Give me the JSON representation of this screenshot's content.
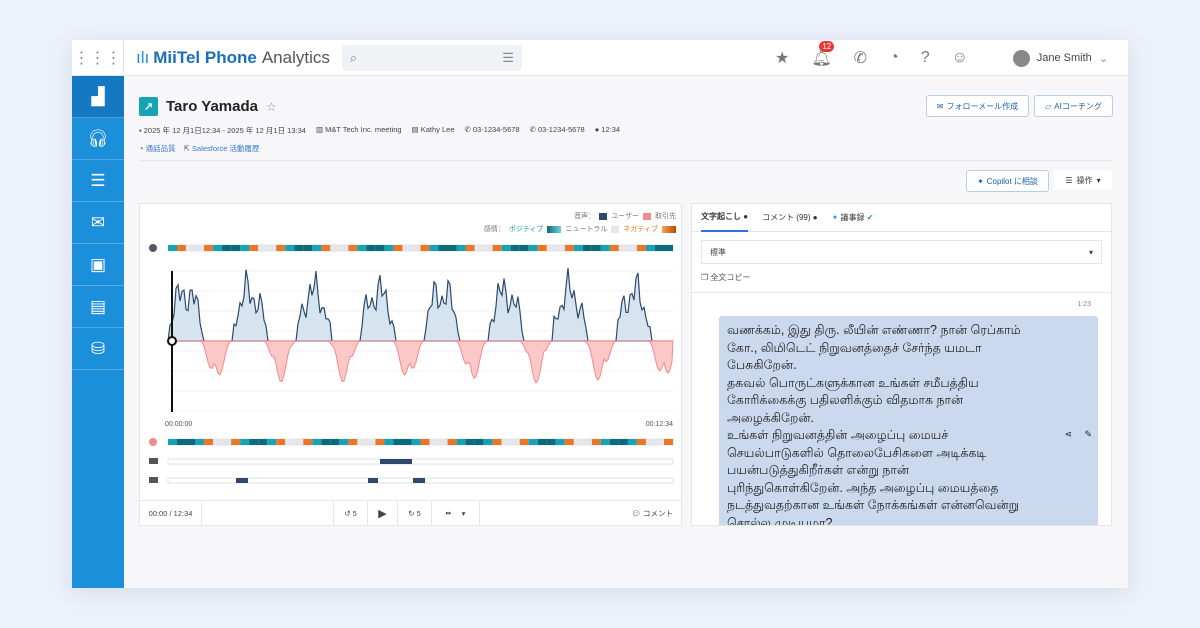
{
  "app": {
    "name_bold": "MiiTel",
    "name_rest": "Phone",
    "name_suffix": "Analytics",
    "notification_count": "12",
    "user": "Jane Smith"
  },
  "sidebar": {
    "items": [
      "analytics-icon",
      "headset-icon",
      "list-icon",
      "sms-icon",
      "contacts-icon",
      "clipboard-icon",
      "database-icon"
    ]
  },
  "record": {
    "title": "Taro Yamada",
    "datetime": "2025 年 12 月1日12:34 - 2025 年 12 月1日 13:34",
    "meeting": "M&T Tech Inc. meeting",
    "contact": "Kathy Lee",
    "phone_out": "03-1234-5678",
    "phone_in": "03-1234-5678",
    "duration": "12:34",
    "quality_link": "通話品質",
    "salesforce_link": "Salesforce 活動履歴"
  },
  "buttons": {
    "follow_mail": "フォローメール作成",
    "ai_coaching": "AIコーチング",
    "copilot": "Copilot に相談",
    "operations": "操作"
  },
  "player": {
    "legend_voice": "音声：",
    "legend_user": "ユーザー",
    "legend_client": "取引先",
    "legend_emotion": "感情：",
    "positive": "ポジティブ",
    "neutral": "ニュートラル",
    "negative": "ネガティブ",
    "time_start": "00:00:00",
    "time_end": "00:12:34",
    "position": "00:00 / 12:34",
    "skip_back": "5",
    "skip_fwd": "5",
    "comment": "コメント",
    "colors": {
      "user": "#2e4a6b",
      "client": "#f28b8b",
      "positive": "#15a3b5",
      "negative": "#e8772a"
    }
  },
  "transcript": {
    "tabs": [
      "文字起こし",
      "コメント (99)",
      "議事録"
    ],
    "mode": "標準",
    "copy_all": "全文コピー",
    "timestamp": "1:23",
    "text": "வணக்கம், இது திரு. லீயின் எண்ணா? நான் ரெப்காம்\nகோ., லிமிடெட் நிறுவனத்தைச் சேர்ந்த யமடா\nபேசுகிறேன்.\nதகவல் பொருட்களுக்கான உங்கள் சமீபத்திய\nகோரிக்கைக்கு பதிலளிக்கும் விதமாக நான்\nஅழைக்கிறேன்.\nஉங்கள் நிறுவனத்தின் அழைப்பு மையச்\nசெயல்பாடுகளில் தொலைபேசிகளை அடிக்கடி\nபயன்படுத்துகிறீர்கள் என்று நான்\nபுரிந்துகொள்கிறேன். அந்த அழைப்பு மையத்தை\nநடத்துவதற்கான உங்கள் நோக்கங்கள் என்னவென்று\nசொல்ல முடியுமா?"
  }
}
